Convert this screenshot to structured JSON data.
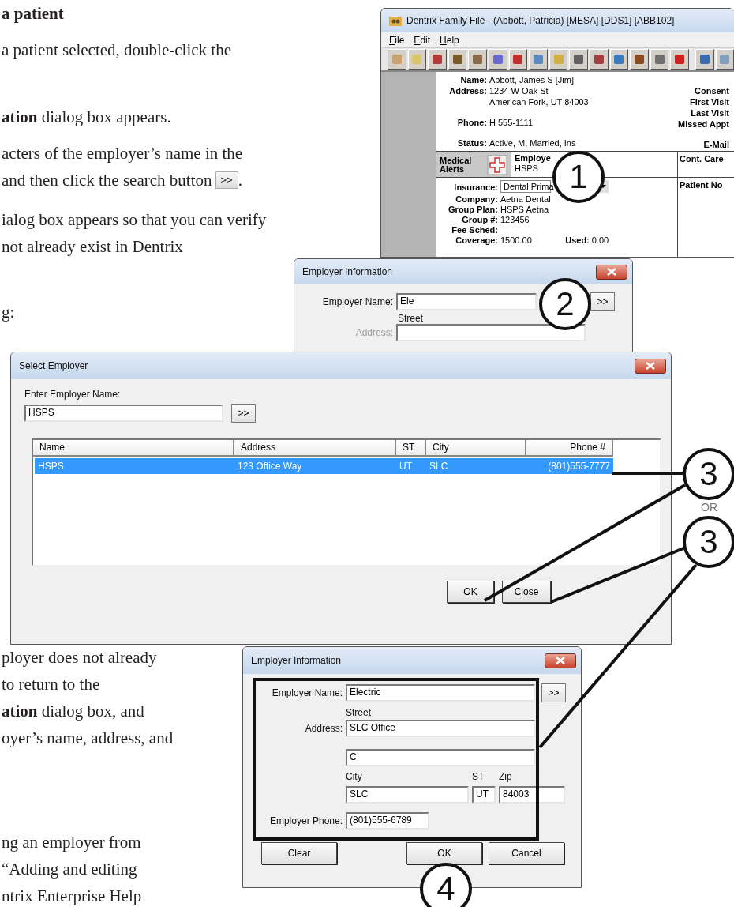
{
  "upper_text": [
    {
      "kind": "heading",
      "lines": [
        "a patient"
      ]
    },
    {
      "kind": "body",
      "lines": [
        "a patient selected, double-click the"
      ]
    },
    {
      "kind": "body",
      "lines": [
        "**ation** dialog box appears."
      ]
    },
    {
      "kind": "body",
      "lines": [
        "acters of the employer’s name in the",
        "and then click the search button"
      ],
      "inline_button": ">>",
      "trailing": "."
    },
    {
      "kind": "body",
      "lines": [
        "ialog box appears so that you can verify",
        "not already exist in Dentrix"
      ]
    },
    {
      "kind": "body",
      "lines": [
        "g:"
      ]
    }
  ],
  "lower_text": [
    {
      "lines": [
        "ployer does not already",
        "to return to the",
        "**ation** dialog box, and",
        "oyer’s name, address, and"
      ]
    },
    {
      "lines": [
        "ng an employer from",
        "“Adding and editing",
        "ntrix Enterprise Help"
      ]
    }
  ],
  "family_file": {
    "title": "Dentrix Family File - (Abbott, Patricia) [MESA] [DDS1] [ABB102]",
    "menu": [
      "File",
      "Edit",
      "Help"
    ],
    "patient_fields": [
      {
        "label": "Name:",
        "value": "Abbott, James S [Jim]"
      },
      {
        "label": "Address:",
        "value": "1234 W Oak St"
      },
      {
        "value": "American Fork, UT  84003"
      },
      {
        "label": "Phone:",
        "value": "H 555-1111"
      },
      {
        "label": "Status:",
        "value": "Active, M, Married, Ins"
      }
    ],
    "right_labels": [
      "Consent",
      "First Visit",
      "Last Visit",
      "Missed Appt",
      "E-Mail"
    ],
    "medical_alerts": "Medical Alerts",
    "employer_label": "Employe",
    "employer_value": "HSPS",
    "cont_care": "Cont. Care",
    "insurance_label": "Insurance:",
    "insurance_value": "Dental Prima",
    "insurance_fields": [
      {
        "label": "Company:",
        "value": "Aetna Dental"
      },
      {
        "label": "Group Plan:",
        "value": "HSPS Aetna"
      },
      {
        "label": "Group #:",
        "value": "123456"
      },
      {
        "label": "Fee Sched:"
      },
      {
        "label": "Coverage:",
        "value": "1500.00"
      }
    ],
    "used_label": "Used:",
    "used_value": "0.00",
    "patient_notes": "Patient No"
  },
  "employer_search": {
    "title": "Employer Information",
    "name_label": "Employer Name:",
    "name_value": "Ele",
    "search_button": ">>",
    "street_label": "Street",
    "address_label": "Address:"
  },
  "select_employer": {
    "title": "Select Employer",
    "prompt": "Enter Employer Name:",
    "value": "HSPS",
    "search_button": ">>",
    "columns": [
      "Name",
      "Address",
      "ST",
      "City",
      "Phone #"
    ],
    "rows": [
      {
        "cells": [
          "HSPS",
          "123 Office Way",
          "UT",
          "SLC",
          "(801)555-7777"
        ],
        "selected": true
      }
    ],
    "buttons": [
      "OK",
      "Close"
    ]
  },
  "employer_entry": {
    "title": "Employer Information",
    "name_label": "Employer Name:",
    "name_value": "Electric",
    "search_button": ">>",
    "street_label": "Street",
    "address_label": "Address:",
    "address_1": "SLC Office",
    "address_2": "C",
    "city_label": "City",
    "st_label": "ST",
    "zip_label": "Zip",
    "city": "SLC",
    "st": "UT",
    "zip": "84003",
    "phone_label": "Employer Phone:",
    "phone": "(801)555-6789",
    "buttons": [
      "Clear",
      "OK",
      "Cancel"
    ]
  },
  "callouts": [
    "1",
    "2",
    "3",
    "3",
    "4"
  ],
  "or_label": "OR"
}
